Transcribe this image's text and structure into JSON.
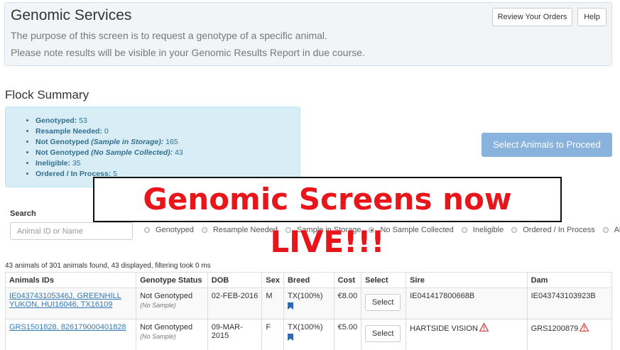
{
  "header": {
    "title": "Genomic Services",
    "description_1": "The purpose of this screen is to request a genotype of a specific animal.",
    "description_2": "Please note results will be visible in your Genomic Results Report in due course.",
    "review_orders_label": "Review Your Orders",
    "help_label": "Help"
  },
  "flock_summary": {
    "title": "Flock Summary",
    "items": [
      {
        "label": "Genotyped:",
        "qualifier": "",
        "value": "53"
      },
      {
        "label": "Resample Needed:",
        "qualifier": "",
        "value": "0"
      },
      {
        "label": "Not Genotyped",
        "qualifier": "(Sample in Storage):",
        "value": "165"
      },
      {
        "label": "Not Genotyped",
        "qualifier": "(No Sample Collected):",
        "value": "43"
      },
      {
        "label": "Ineligible:",
        "qualifier": "",
        "value": "35"
      },
      {
        "label": "Ordered / In Process:",
        "qualifier": "",
        "value": "5"
      }
    ]
  },
  "proceed_label": "Select Animals to Proceed",
  "banner_text": "Genomic Screens now LIVE!!!",
  "search": {
    "label": "Search",
    "placeholder": "Animal ID or Name",
    "value": ""
  },
  "filters": [
    {
      "label": "Genotyped",
      "checked": false
    },
    {
      "label": "Resample Needed",
      "checked": false
    },
    {
      "label": "Sample in Storage",
      "checked": false
    },
    {
      "label": "No Sample Collected",
      "checked": true
    },
    {
      "label": "Ineligible",
      "checked": false
    },
    {
      "label": "Ordered / In Process",
      "checked": false
    },
    {
      "label": "All",
      "checked": false
    }
  ],
  "results_info": "43 animals of 301 animals found, 43 displayed, filtering took 0 ms",
  "table": {
    "columns": [
      "Animals IDs",
      "Genotype Status",
      "DOB",
      "Sex",
      "Breed",
      "Cost",
      "Select",
      "Sire",
      "Dam"
    ],
    "rows": [
      {
        "ids": "IE043743105346J, GREENHILL YUKON, HUI16046, TX16109",
        "status": "Not Genotyped",
        "status_sub": "(No Sample)",
        "dob": "02-FEB-2016",
        "sex": "M",
        "breed": "TX(100%)",
        "cost": "€8.00",
        "select_label": "Select",
        "sire": "IE041417800668B",
        "sire_warning": false,
        "dam": "IE043743103923B",
        "dam_warning": false
      },
      {
        "ids": "GRS1501828, 826179000401828",
        "status": "Not Genotyped",
        "status_sub": "(No Sample)",
        "dob": "09-MAR-2015",
        "sex": "F",
        "breed": "TX(100%)",
        "cost": "€5.00",
        "select_label": "Select",
        "sire": "HARTSIDE VISION",
        "sire_warning": true,
        "dam": "GRS1200879",
        "dam_warning": true
      }
    ]
  },
  "colors": {
    "info_bg": "#d9edf7",
    "info_text": "#31708f",
    "primary_disabled": "#89b3dd",
    "banner_red": "#e8151b",
    "link": "#337ab7",
    "warning": "#d9534f"
  }
}
